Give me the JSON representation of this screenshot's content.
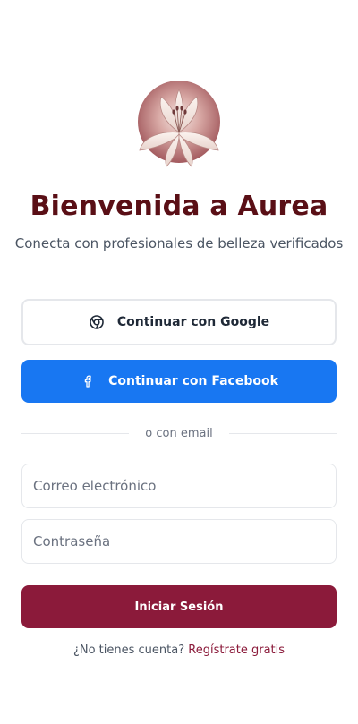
{
  "header": {
    "title": "Bienvenida a Aurea",
    "subtitle": "Conecta con profesionales de belleza verificados",
    "logo_icon": "lily-flower-icon"
  },
  "social": {
    "google_label": "Continuar con Google",
    "google_icon": "google-icon",
    "facebook_label": "Continuar con Facebook",
    "facebook_icon": "facebook-icon"
  },
  "divider": {
    "text": "o con email"
  },
  "form": {
    "email_placeholder": "Correo electrónico",
    "email_value": "",
    "password_placeholder": "Contraseña",
    "password_value": "",
    "submit_label": "Iniciar Sesión"
  },
  "footer": {
    "prompt": "¿No tienes cuenta?",
    "link_label": "Regístrate gratis"
  },
  "colors": {
    "brand": "#8b1a3a",
    "title": "#5a0f16",
    "facebook": "#1877f2",
    "border": "#e5e7eb"
  }
}
